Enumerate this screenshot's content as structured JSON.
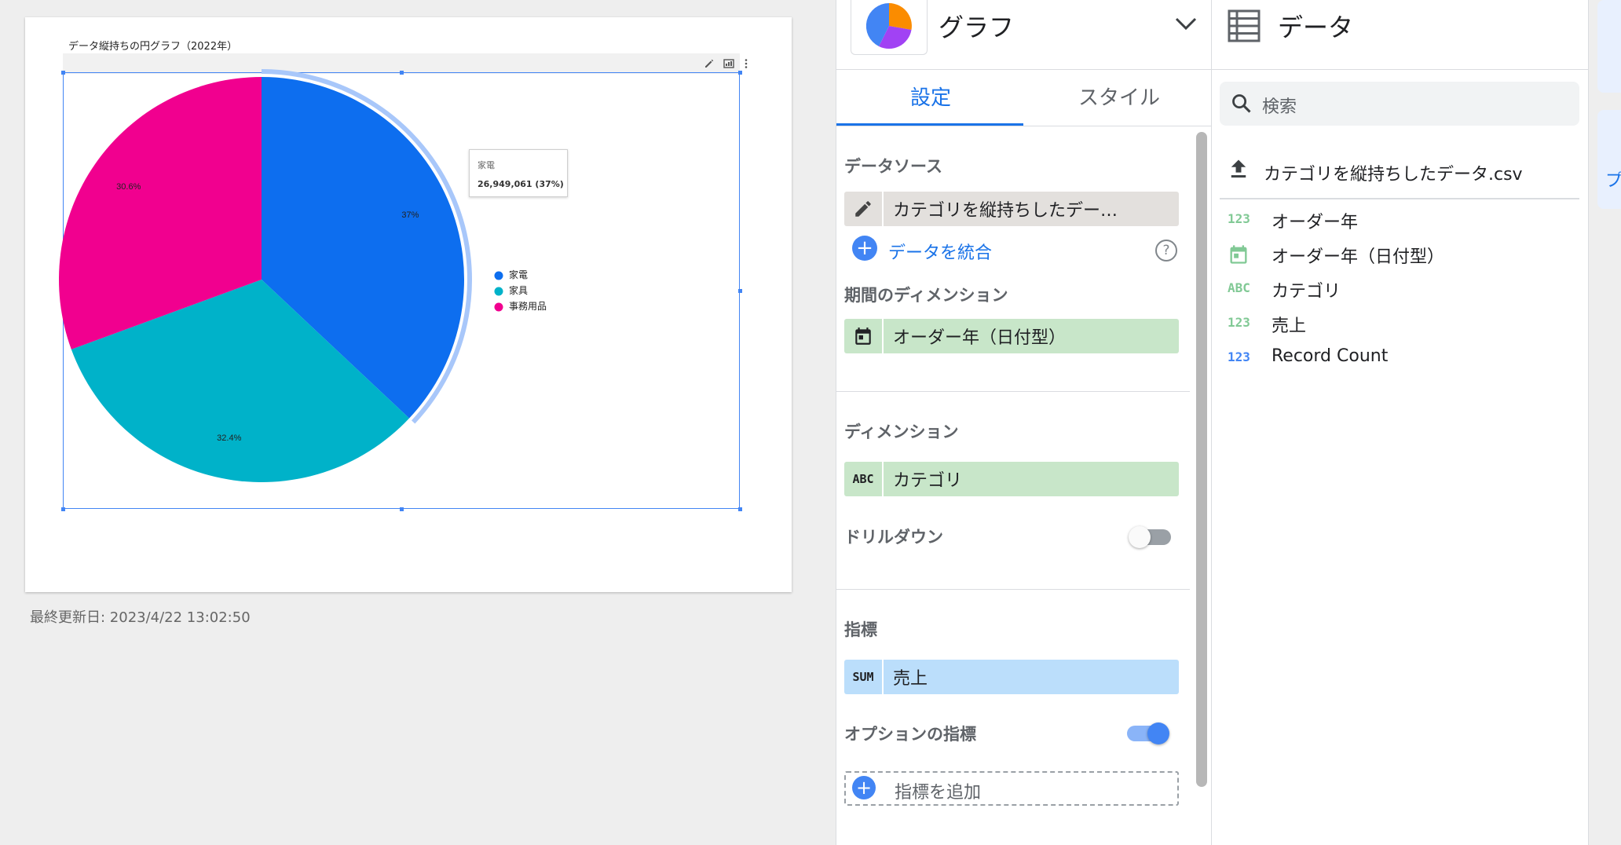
{
  "report": {
    "chart_title": "データ縦持ちの円グラフ（2022年）",
    "last_updated": "最終更新日: 2023/4/22 13:02:50"
  },
  "chart_data": {
    "type": "pie",
    "title": "データ縦持ちの円グラフ（2022年）",
    "categories": [
      "家電",
      "家具",
      "事務用品"
    ],
    "values": [
      37,
      32.4,
      30.6
    ],
    "labels": [
      "37%",
      "32.4%",
      "30.6%"
    ],
    "colors": [
      "#0d6eef",
      "#00b2c9",
      "#f1008f"
    ],
    "legend_position": "right",
    "highlighted": "家電",
    "tooltip": {
      "label": "家電",
      "value": "26,949,061 (37%)"
    }
  },
  "props_panel": {
    "chart_type_label": "グラフ",
    "tabs": [
      {
        "label": "設定",
        "active": true
      },
      {
        "label": "スタイル",
        "active": false
      }
    ],
    "data_source": {
      "title": "データソース",
      "chip": "カテゴリを縦持ちしたデー…",
      "blend_link": "データを統合"
    },
    "date_dimension": {
      "title": "期間のディメンション",
      "chip": "オーダー年（日付型）"
    },
    "dimension": {
      "title": "ディメンション",
      "tag": "ABC",
      "chip": "カテゴリ"
    },
    "drilldown": {
      "label": "ドリルダウン",
      "enabled": false
    },
    "metric": {
      "title": "指標",
      "tag": "SUM",
      "chip": "売上"
    },
    "optional_metric": {
      "label": "オプションの指標",
      "enabled": true
    },
    "add_metric": "指標を追加"
  },
  "data_panel": {
    "title": "データ",
    "search_placeholder": "検索",
    "data_source_name": "カテゴリを縦持ちしたデータ.csv",
    "fields": [
      {
        "tag": "123",
        "name": "オーダー年",
        "tag_color": "#81c995",
        "icon": null
      },
      {
        "tag": "",
        "name": "オーダー年（日付型）",
        "tag_color": "#81c995",
        "icon": "calendar-icon"
      },
      {
        "tag": "ABC",
        "name": "カテゴリ",
        "tag_color": "#81c995",
        "icon": null
      },
      {
        "tag": "123",
        "name": "売上",
        "tag_color": "#81c995",
        "icon": null
      },
      {
        "tag": "123",
        "name": "Record Count",
        "tag_color": "#4285f4",
        "icon": null
      }
    ]
  },
  "edge": {
    "partial_text": "プ"
  }
}
